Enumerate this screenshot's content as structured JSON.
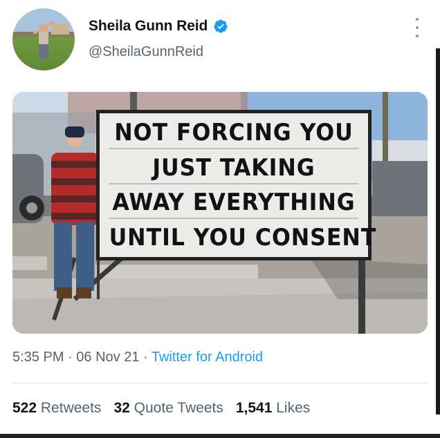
{
  "tweet": {
    "display_name": "Sheila Gunn Reid",
    "handle": "@SheilaGunnReid",
    "sign_lines": [
      "NOT FORCING YOU",
      "JUST TAKING",
      "AWAY EVERYTHING",
      "UNTIL YOU CONSENT"
    ],
    "time": "5:35 PM",
    "sep1": " · ",
    "date": "06 Nov 21",
    "sep2": " · ",
    "source": "Twitter for Android"
  },
  "stats": {
    "retweets_count": "522",
    "retweets_label": "Retweets",
    "quotes_count": "32",
    "quotes_label": "Quote Tweets",
    "likes_count": "1,541",
    "likes_label": "Likes"
  },
  "colors": {
    "accent": "#1d9bf0",
    "secondary_text": "#536471",
    "primary_text": "#0f1419"
  },
  "icons": {
    "verified": "verified-badge-icon",
    "more": "more-vertical-icon"
  }
}
